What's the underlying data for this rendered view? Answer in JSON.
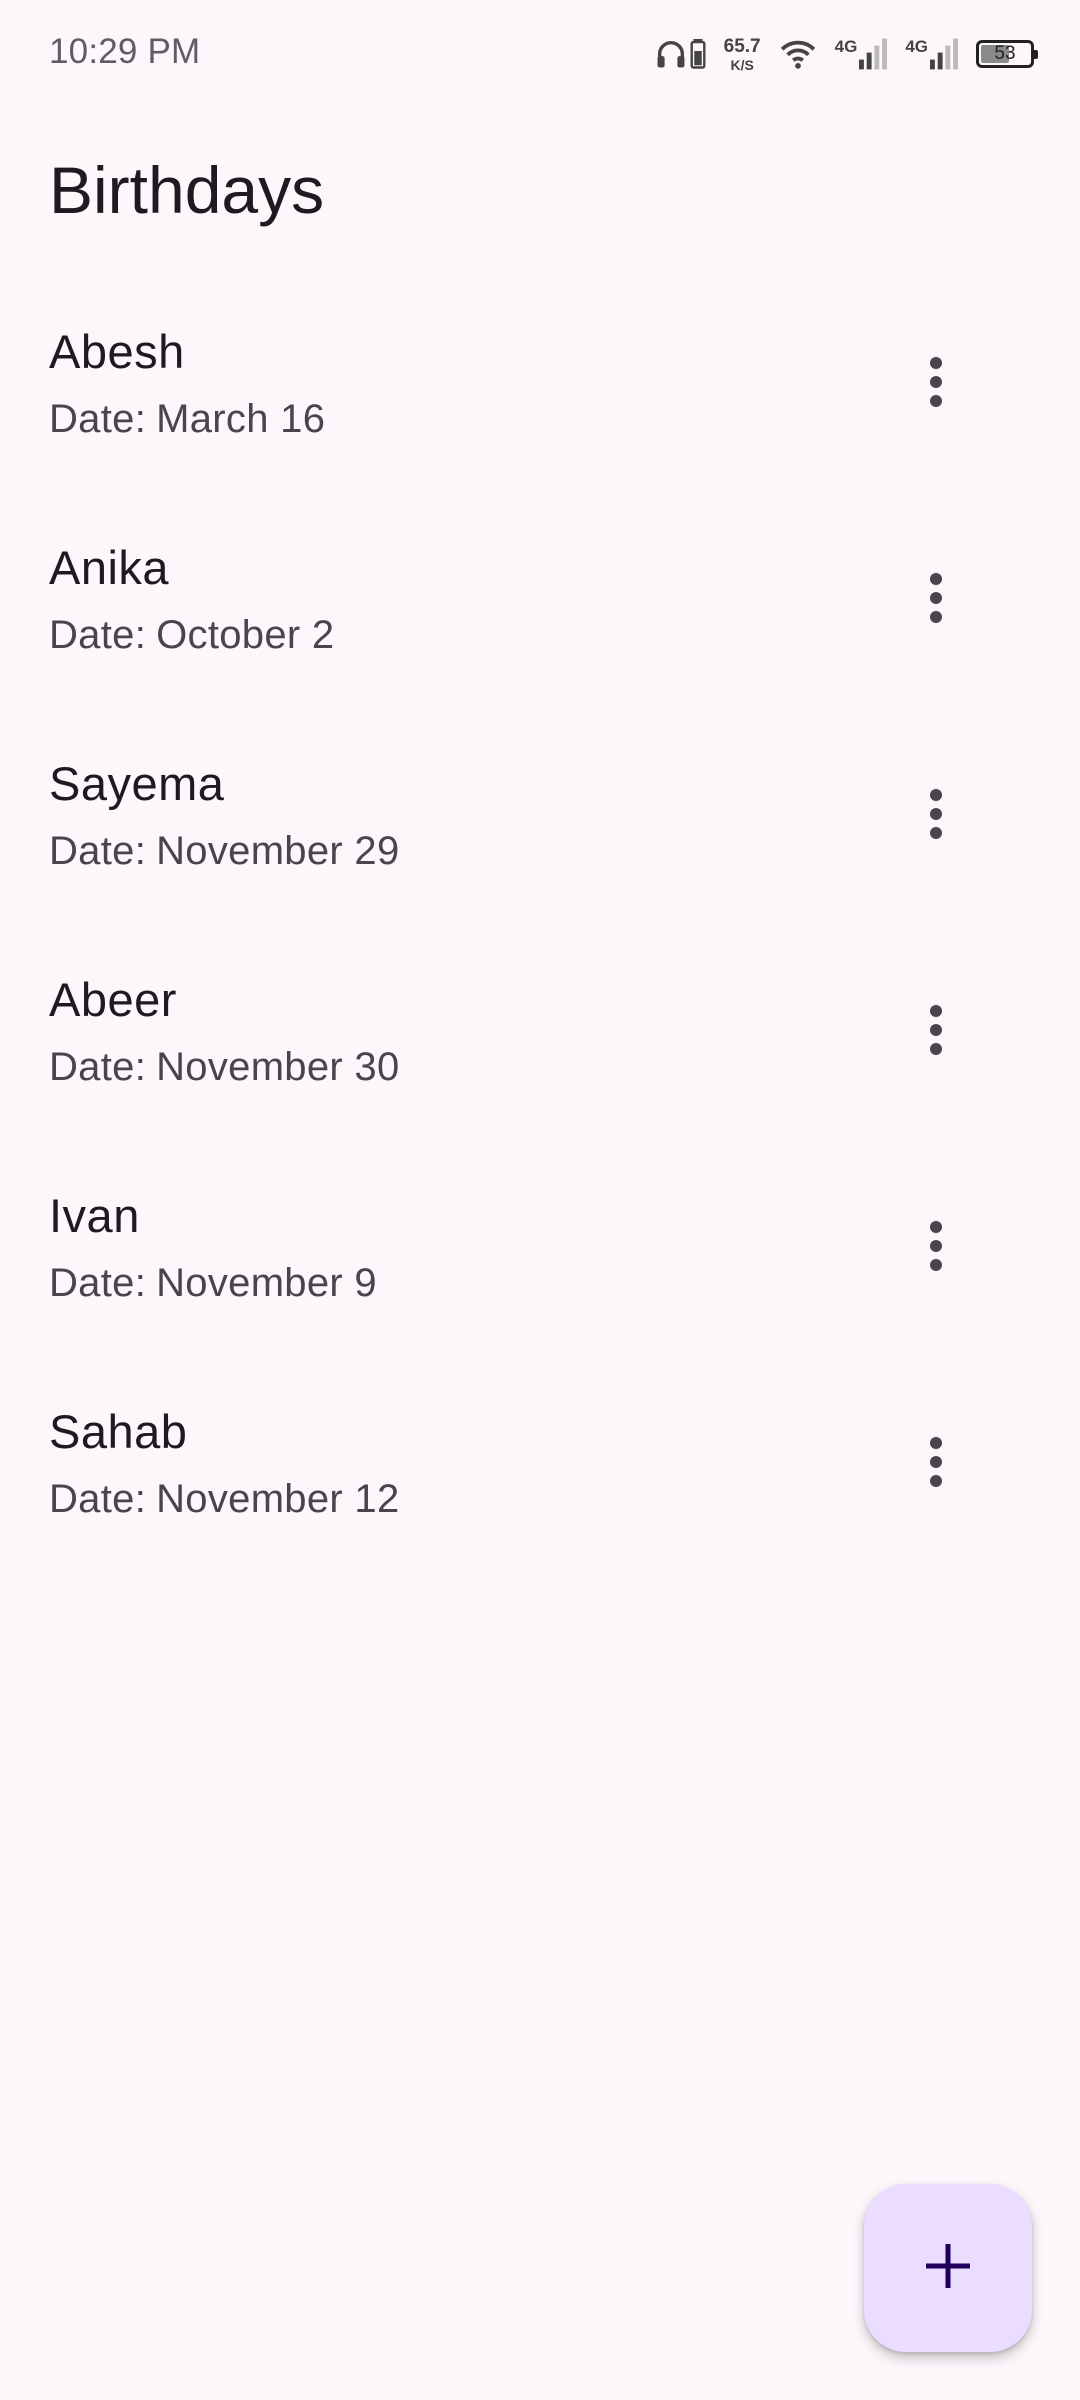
{
  "status_bar": {
    "time": "10:29 PM",
    "net_speed_value": "65.7",
    "net_speed_unit": "K/S",
    "network_1": "4G",
    "network_2": "4G",
    "battery_level": "53",
    "icons": [
      "headphones-icon",
      "battery-saver-icon",
      "wifi-icon",
      "signal-icon",
      "signal-icon",
      "battery-icon"
    ]
  },
  "page": {
    "title": "Birthdays"
  },
  "list": {
    "date_prefix": "Date:",
    "items": [
      {
        "name": "Abesh",
        "date": "March 16"
      },
      {
        "name": "Anika",
        "date": "October 2"
      },
      {
        "name": "Sayema",
        "date": "November 29"
      },
      {
        "name": "Abeer",
        "date": "November 30"
      },
      {
        "name": "Ivan",
        "date": "November 9"
      },
      {
        "name": "Sahab",
        "date": "November 12"
      }
    ],
    "item_menu_icon": "more-vert-icon"
  },
  "fab": {
    "icon": "add-icon"
  },
  "colors": {
    "background": "#fdf7fc",
    "fab_background": "#eaddff",
    "primary_text": "#1d1b20",
    "secondary_text": "#49454f",
    "icon": "#49454f"
  }
}
